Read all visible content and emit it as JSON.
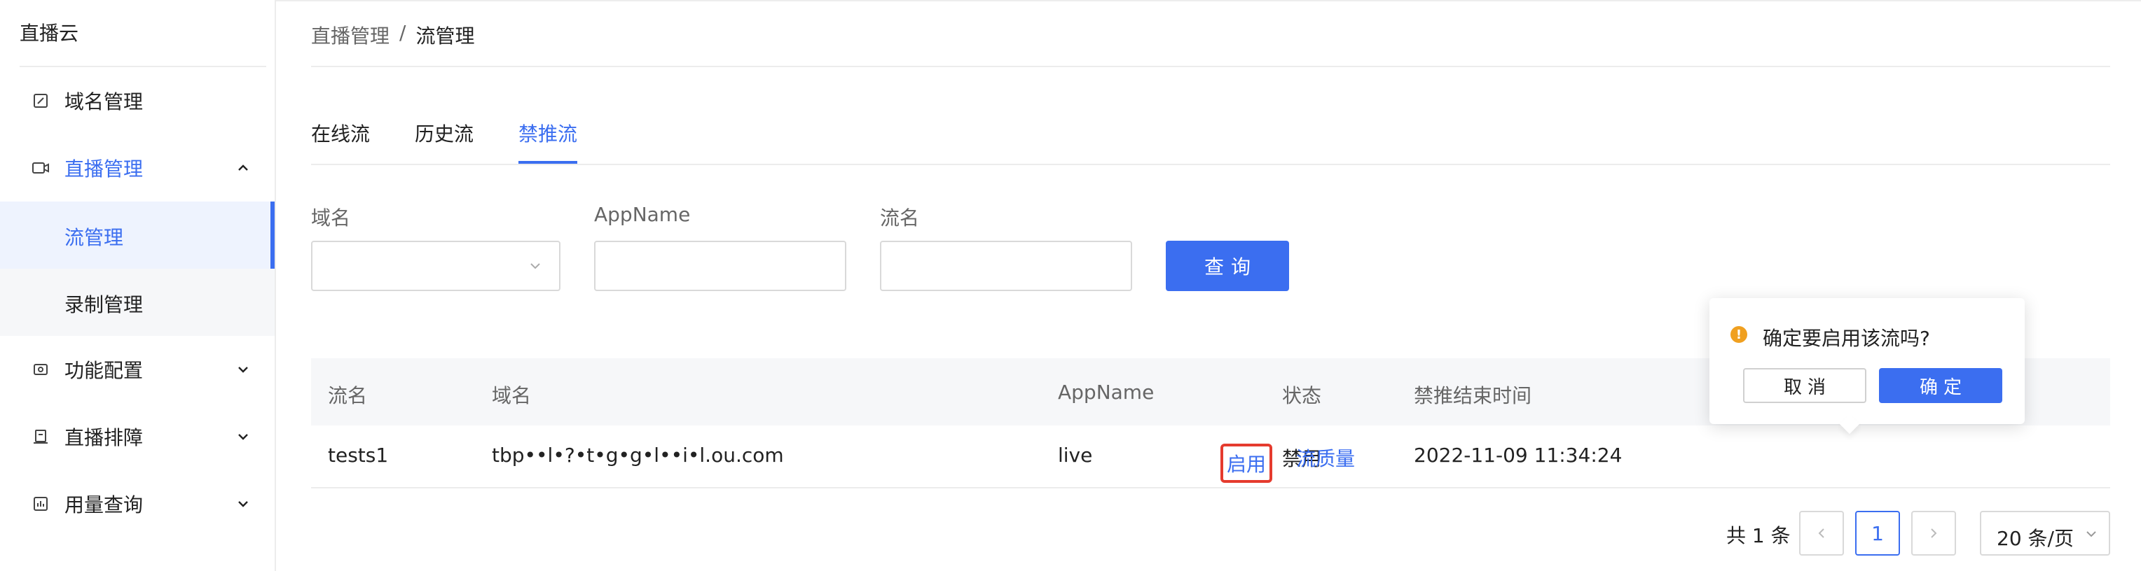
{
  "sidebar": {
    "brand": "直播云",
    "items": [
      {
        "label": "域名管理",
        "icon": "edit-icon"
      },
      {
        "label": "直播管理",
        "icon": "video-camera-icon",
        "expanded": true,
        "children": [
          {
            "label": "流管理",
            "active": true
          },
          {
            "label": "录制管理"
          }
        ]
      },
      {
        "label": "功能配置",
        "icon": "config-icon"
      },
      {
        "label": "直播排障",
        "icon": "troubleshoot-icon"
      },
      {
        "label": "用量查询",
        "icon": "chart-icon"
      }
    ]
  },
  "breadcrumb": {
    "parent": "直播管理",
    "separator": "/",
    "current": "流管理"
  },
  "tabs": [
    {
      "label": "在线流"
    },
    {
      "label": "历史流"
    },
    {
      "label": "禁推流",
      "active": true
    }
  ],
  "filters": {
    "domain_label": "域名",
    "appname_label": "AppName",
    "stream_label": "流名",
    "domain_value": "",
    "appname_value": "",
    "stream_value": "",
    "query_button": "查询"
  },
  "table": {
    "columns": [
      "流名",
      "域名",
      "AppName",
      "状态",
      "禁推结束时间"
    ],
    "rows": [
      {
        "stream": "tests1",
        "domain": "tbp••l•?•t•g•g•l••i•l.ou.com",
        "appname": "live",
        "status": "禁用",
        "ban_end_time": "2022-11-09 11:34:24",
        "actions": [
          "启用",
          "流质量"
        ]
      }
    ]
  },
  "pagination": {
    "total_text": "共 1 条",
    "current_page": "1",
    "page_size": "20 条/页"
  },
  "popconfirm": {
    "message": "确定要启用该流吗?",
    "cancel": "取消",
    "confirm": "确定"
  },
  "colors": {
    "primary": "#3b6ef0",
    "highlight_border": "#e53b2e",
    "warning": "#f0a020"
  }
}
